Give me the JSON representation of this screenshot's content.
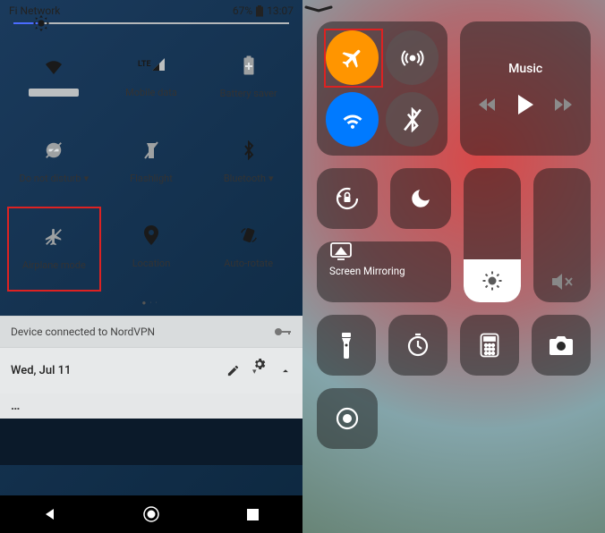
{
  "android": {
    "status": {
      "network": "Fi Network",
      "battery_pct": "67%",
      "time": "13:07"
    },
    "tiles": {
      "wifi": "",
      "mobile_data": "Mobile data",
      "battery_saver": "Battery saver",
      "dnd": "Do not disturb",
      "flashlight": "Flashlight",
      "bluetooth": "Bluetooth",
      "airplane": "Airplane mode",
      "location": "Location",
      "autorotate": "Auto-rotate"
    },
    "vpn_row": "Device connected to NordVPN",
    "date_row": "Wed, Jul 11",
    "overflow": "…"
  },
  "ios": {
    "music_title": "Music",
    "screen_mirroring": "Screen Mirroring"
  }
}
